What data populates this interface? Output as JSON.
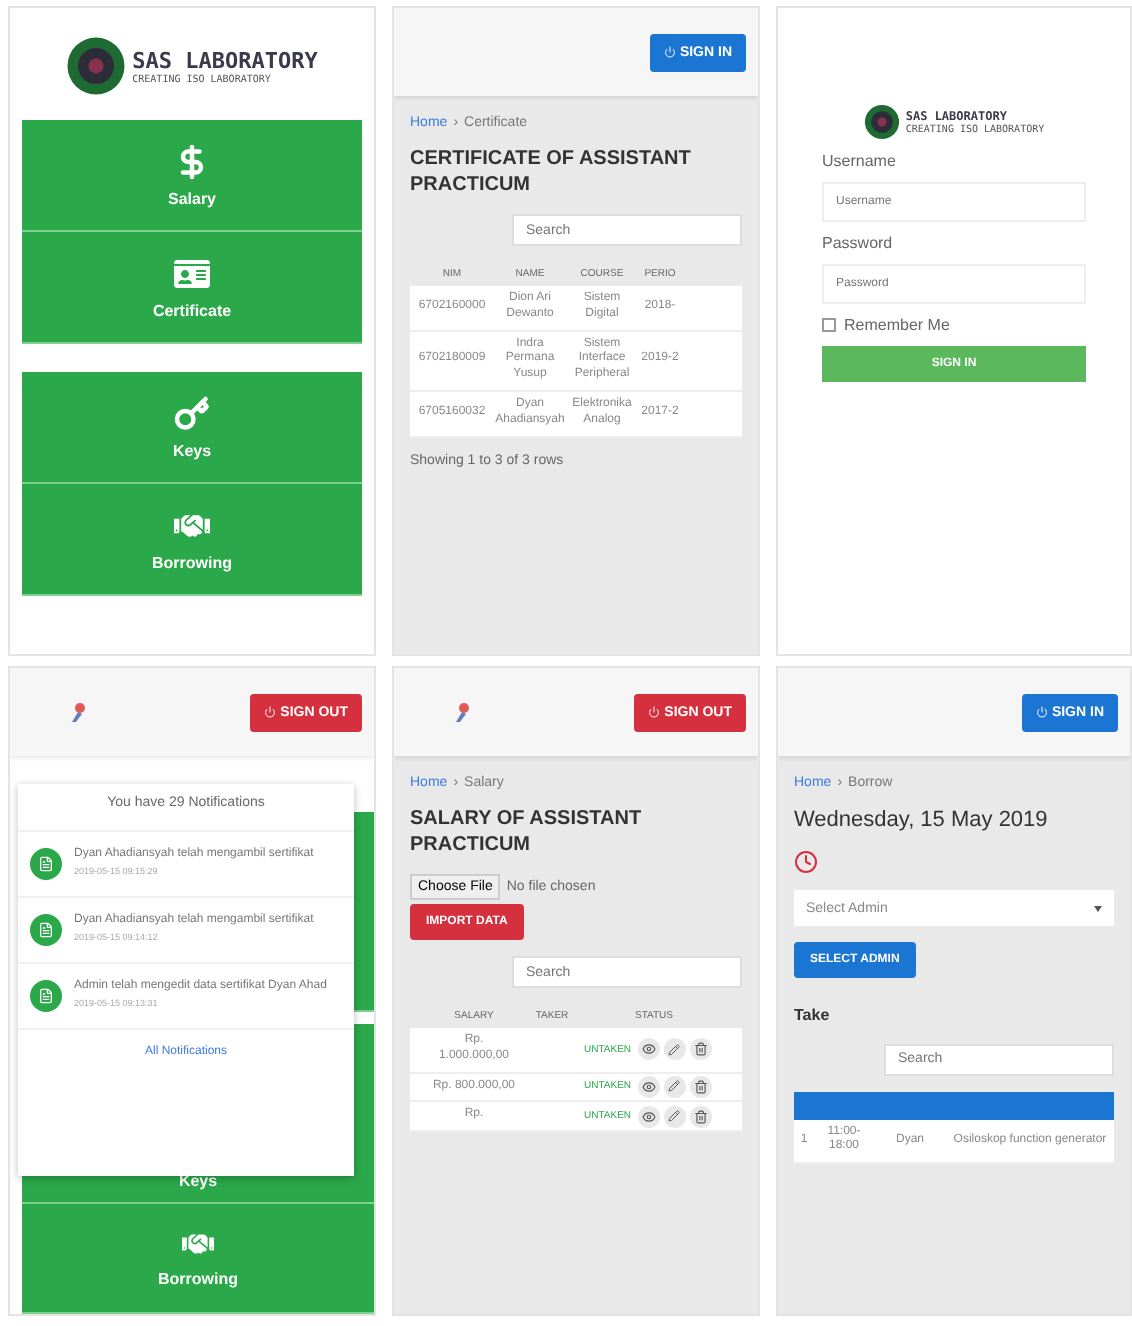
{
  "menu_screen": {
    "logo": {
      "title": "SAS LABORATORY",
      "subtitle": "CREATING ISO LABORATORY"
    },
    "menu_groups": [
      {
        "items": [
          {
            "kind": "salary",
            "label": "Salary"
          },
          {
            "kind": "certificate",
            "label": "Certificate"
          }
        ]
      },
      {
        "items": [
          {
            "kind": "keys",
            "label": "Keys"
          },
          {
            "kind": "borrowing",
            "label": "Borrowing"
          }
        ]
      }
    ]
  },
  "certificate_screen": {
    "header": {
      "kind": "sign_in",
      "label": "SIGN IN"
    },
    "breadcrumb": {
      "link": "Home",
      "separator": "›",
      "current": "Certificate"
    },
    "title": "CERTIFICATE OF ASSISTANT PRACTICUM",
    "search": {
      "placeholder": "Search"
    },
    "table": {
      "columns": [
        "NIM",
        "NAME",
        "COURSE",
        "PERIO"
      ],
      "rows": [
        [
          "6702160000",
          "Dion Ari Dewanto",
          "Sistem Digital",
          "2018-"
        ],
        [
          "6702180009",
          "Indra Permana Yusup",
          "Sistem Interface Peripheral",
          "2019-2"
        ],
        [
          "6705160032",
          "Dyan Ahadiansyah",
          "Elektronika Analog",
          "2017-2"
        ]
      ]
    },
    "footer": "Showing 1 to 3 of 3 rows"
  },
  "login_screen": {
    "logo": {
      "title": "SAS LABORATORY",
      "subtitle": "CREATING ISO LABORATORY"
    },
    "fields": [
      {
        "label": "Username",
        "placeholder": "Username"
      },
      {
        "label": "Password",
        "placeholder": "Password"
      }
    ],
    "remember": {
      "label": "Remember Me",
      "checked": false
    },
    "button": "SIGN IN"
  },
  "notifications_screen": {
    "header": {
      "kind": "sign_out",
      "label": "SIGN OUT"
    },
    "background_tiles": [
      {
        "kind": "blank"
      },
      {
        "kind": "keys",
        "label": "Keys"
      },
      {
        "kind": "borrowing",
        "label": "Borrowing"
      }
    ],
    "dropdown": {
      "title": "You have 29 Notifications",
      "items": [
        {
          "text": "Dyan Ahadiansyah telah mengambil sertifikat",
          "time": "2019-05-15 09:15:29"
        },
        {
          "text": "Dyan Ahadiansyah telah mengambil sertifikat",
          "time": "2019-05-15 09:14:12"
        },
        {
          "text": "Admin telah mengedit data sertifikat Dyan Ahad",
          "time": "2019-05-15 09:13:31"
        }
      ],
      "footer": "All Notifications"
    }
  },
  "salary_screen": {
    "header": {
      "kind": "sign_out",
      "label": "SIGN OUT"
    },
    "breadcrumb": {
      "link": "Home",
      "separator": "›",
      "current": "Salary"
    },
    "title": "SALARY OF ASSISTANT PRACTICUM",
    "file": {
      "button": "Choose File",
      "status": "No file chosen"
    },
    "import_button": "IMPORT DATA",
    "search": {
      "placeholder": "Search"
    },
    "table": {
      "columns": [
        "SALARY",
        "TAKER",
        "STATUS"
      ],
      "rows": [
        {
          "salary": "Rp. 1.000.000,00",
          "status": "UNTAKEN"
        },
        {
          "salary": "Rp. 800.000,00",
          "status": "UNTAKEN"
        },
        {
          "salary": "Rp.",
          "status": "UNTAKEN"
        }
      ]
    }
  },
  "borrow_screen": {
    "header": {
      "kind": "sign_in",
      "label": "SIGN IN"
    },
    "breadcrumb": {
      "link": "Home",
      "separator": "›",
      "current": "Borrow"
    },
    "date": "Wednesday, 15 May 2019",
    "select": {
      "placeholder": "Select Admin"
    },
    "select_button": "SELECT ADMIN",
    "section": "Take",
    "search": {
      "placeholder": "Search"
    },
    "rows": [
      {
        "no": "1",
        "time": "11:00- 18:00",
        "name": "Dyan",
        "item": "Osiloskop function generator"
      }
    ]
  }
}
